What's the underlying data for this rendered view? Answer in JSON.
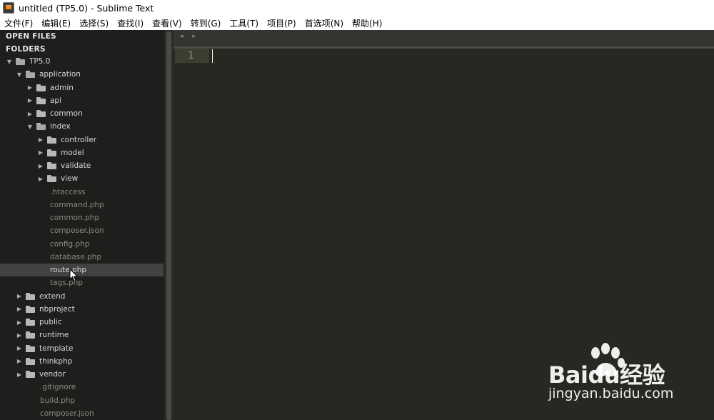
{
  "window": {
    "title": "untitled (TP5.0) - Sublime Text"
  },
  "menu": [
    "文件(F)",
    "编辑(E)",
    "选择(S)",
    "查找(I)",
    "查看(V)",
    "转到(G)",
    "工具(T)",
    "项目(P)",
    "首选项(N)",
    "帮助(H)"
  ],
  "sidebar": {
    "open_files_label": "OPEN FILES",
    "folders_label": "FOLDERS",
    "tree": [
      {
        "name": "TP5.0",
        "type": "folder",
        "depth": 0,
        "expanded": true
      },
      {
        "name": "application",
        "type": "folder",
        "depth": 1,
        "expanded": true
      },
      {
        "name": "admin",
        "type": "folder",
        "depth": 2,
        "expanded": false
      },
      {
        "name": "api",
        "type": "folder",
        "depth": 2,
        "expanded": false
      },
      {
        "name": "common",
        "type": "folder",
        "depth": 2,
        "expanded": false
      },
      {
        "name": "index",
        "type": "folder",
        "depth": 2,
        "expanded": true
      },
      {
        "name": "controller",
        "type": "folder",
        "depth": 3,
        "expanded": false
      },
      {
        "name": "model",
        "type": "folder",
        "depth": 3,
        "expanded": false
      },
      {
        "name": "validate",
        "type": "folder",
        "depth": 3,
        "expanded": false
      },
      {
        "name": "view",
        "type": "folder",
        "depth": 3,
        "expanded": false
      },
      {
        "name": ".htaccess",
        "type": "file",
        "depth": 2
      },
      {
        "name": "command.php",
        "type": "file",
        "depth": 2
      },
      {
        "name": "common.php",
        "type": "file",
        "depth": 2
      },
      {
        "name": "composer.json",
        "type": "file",
        "depth": 2
      },
      {
        "name": "config.php",
        "type": "file",
        "depth": 2
      },
      {
        "name": "database.php",
        "type": "file",
        "depth": 2
      },
      {
        "name": "route.php",
        "type": "file",
        "depth": 2,
        "selected": true
      },
      {
        "name": "tags.php",
        "type": "file",
        "depth": 2
      },
      {
        "name": "extend",
        "type": "folder",
        "depth": 1,
        "expanded": false
      },
      {
        "name": "nbproject",
        "type": "folder",
        "depth": 1,
        "expanded": false
      },
      {
        "name": "public",
        "type": "folder",
        "depth": 1,
        "expanded": false
      },
      {
        "name": "runtime",
        "type": "folder",
        "depth": 1,
        "expanded": false
      },
      {
        "name": "template",
        "type": "folder",
        "depth": 1,
        "expanded": false
      },
      {
        "name": "thinkphp",
        "type": "folder",
        "depth": 1,
        "expanded": false
      },
      {
        "name": "vendor",
        "type": "folder",
        "depth": 1,
        "expanded": false
      },
      {
        "name": ".gitignore",
        "type": "file",
        "depth": 1
      },
      {
        "name": "build.php",
        "type": "file",
        "depth": 1
      },
      {
        "name": "composer.json",
        "type": "file",
        "depth": 1
      }
    ]
  },
  "tabstrip": {
    "arrows": "◂ ▸"
  },
  "editor": {
    "line_number": "1"
  },
  "watermark": {
    "logo": "Baidu经验",
    "url": "jingyan.baidu.com"
  },
  "colors": {
    "editor_bg": "#272822",
    "sidebar_bg": "#1e1f1c",
    "selection": "#424242"
  }
}
